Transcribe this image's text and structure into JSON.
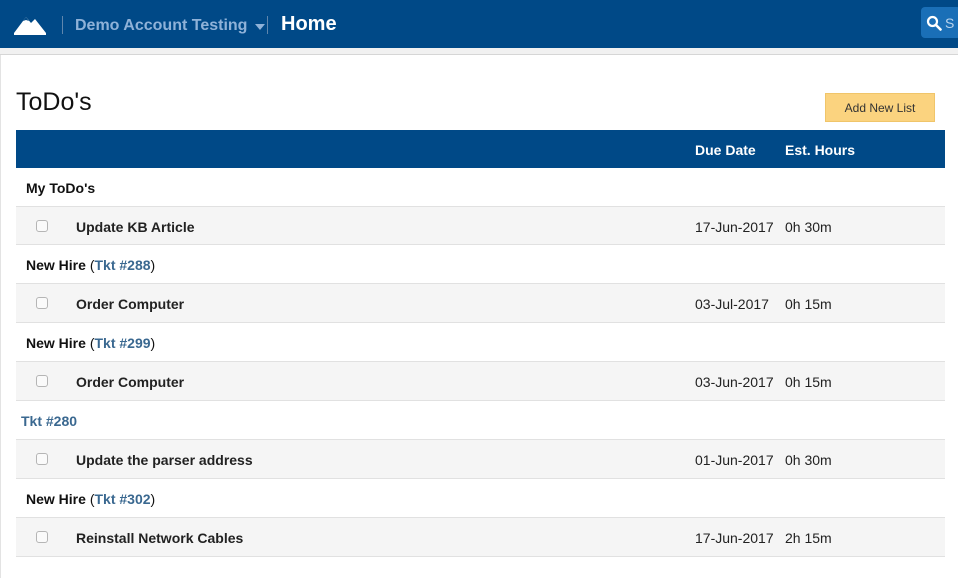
{
  "header": {
    "account_name": "Demo Account Testing",
    "page_name": "Home",
    "search_placeholder": "S",
    "colors": {
      "bar": "#004987",
      "account_text": "#8fb2d8",
      "search": "#1a6fb7"
    }
  },
  "page": {
    "title": "ToDo's",
    "add_button": "Add New List",
    "colors": {
      "add_button": "#fbd37f",
      "link": "#3a6890"
    }
  },
  "table": {
    "columns": {
      "due_date": "Due Date",
      "est_hours": "Est. Hours"
    },
    "groups": [
      {
        "title": "My ToDo's",
        "open": "",
        "link": "",
        "close": "",
        "tasks": [
          {
            "name": "Update KB Article",
            "due": "17-Jun-2017",
            "hours": "0h 30m"
          }
        ]
      },
      {
        "title": "New Hire ",
        "open": "(",
        "link": "Tkt #288",
        "close": ")",
        "tasks": [
          {
            "name": "Order Computer",
            "due": "03-Jul-2017",
            "hours": "0h 15m"
          }
        ]
      },
      {
        "title": "New Hire ",
        "open": "(",
        "link": "Tkt #299",
        "close": ")",
        "tasks": [
          {
            "name": "Order Computer",
            "due": "03-Jun-2017",
            "hours": "0h 15m"
          }
        ]
      },
      {
        "title": "",
        "open": "",
        "link": "Tkt #280",
        "close": "",
        "tasks": [
          {
            "name": "Update the parser address",
            "due": "01-Jun-2017",
            "hours": "0h 30m"
          }
        ]
      },
      {
        "title": "New Hire ",
        "open": "(",
        "link": "Tkt #302",
        "close": ")",
        "tasks": [
          {
            "name": "Reinstall Network Cables",
            "due": "17-Jun-2017",
            "hours": "2h 15m"
          }
        ]
      }
    ]
  }
}
